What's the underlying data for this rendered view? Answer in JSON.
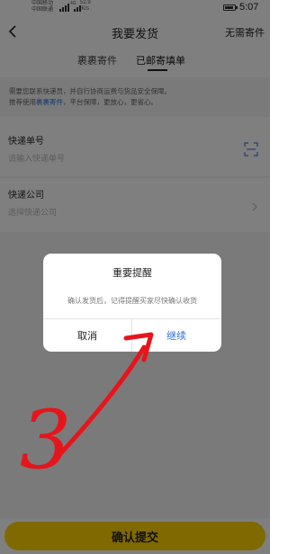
{
  "status_bar": {
    "carrier_1": "中国移动",
    "carrier_2": "中国联通",
    "network": "4G",
    "speed_value": "52.9",
    "speed_unit": "K/s",
    "time": "5:07"
  },
  "nav": {
    "title": "我要发货",
    "right_label": "无需寄件"
  },
  "tabs": [
    {
      "label": "裹裹寄件",
      "active": false
    },
    {
      "label": "已邮寄填单",
      "active": true
    }
  ],
  "notice": {
    "line1": "需要您联系快递员，并自行协商运费与货品安全保障。",
    "line2_prefix": "推荐使用",
    "line2_link": "裹裹寄件",
    "line2_suffix": "，平台保障，更放心，更省心。"
  },
  "form": {
    "tracking_label": "快递单号",
    "tracking_placeholder": "请输入快递单号",
    "company_label": "快递公司",
    "company_placeholder": "选择快递公司"
  },
  "bottom": {
    "confirm_label": "确认提交"
  },
  "dialog": {
    "title": "重要提醒",
    "message": "确认发货后，记得提醒买家尽快确认收货",
    "cancel_label": "取消",
    "continue_label": "继续"
  },
  "annotation": {
    "step_number": "3",
    "color": "#e8141b"
  },
  "colors": {
    "accent_yellow": "#ffd200",
    "link_blue": "#2f6fd8"
  }
}
